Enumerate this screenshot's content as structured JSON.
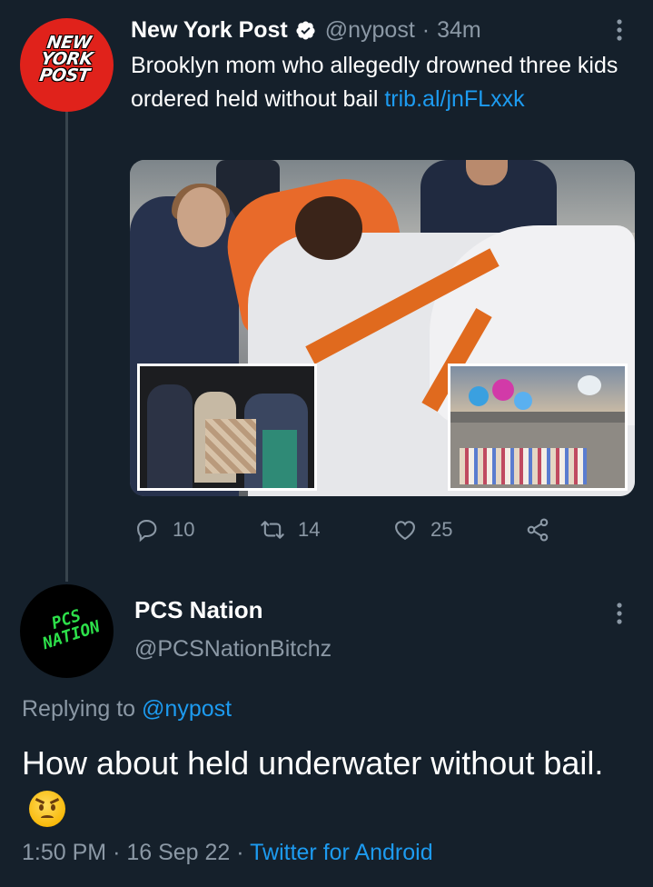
{
  "tweet": {
    "author_name": "New York Post",
    "handle": "@nypost",
    "separator": "·",
    "time": "34m",
    "text": "Brooklyn mom who allegedly drowned three kids ordered held without bail ",
    "link_text": "trib.al/jnFLxxk",
    "avatar_logo": "NEW YORK POST",
    "more_icon": "more-vertical-icon",
    "actions": {
      "reply_count": "10",
      "retweet_count": "14",
      "like_count": "25"
    }
  },
  "reply": {
    "author_name": "PCS Nation",
    "handle": "@PCSNationBitchz",
    "avatar_text": "PCS NATION",
    "replying_prefix": "Replying to ",
    "replying_to": "@nypost",
    "text": "How about held underwater without bail.",
    "emoji": "angry-face-icon",
    "time": "1:50 PM",
    "dot": "·",
    "date": "16 Sep 22",
    "source": "Twitter for Android"
  },
  "colors": {
    "background": "#15202b",
    "secondary_text": "#8b98a5",
    "link": "#1d9bf0",
    "verified": "#ffffff",
    "nyp_red": "#e0221b",
    "pcs_green": "#2de04a"
  }
}
